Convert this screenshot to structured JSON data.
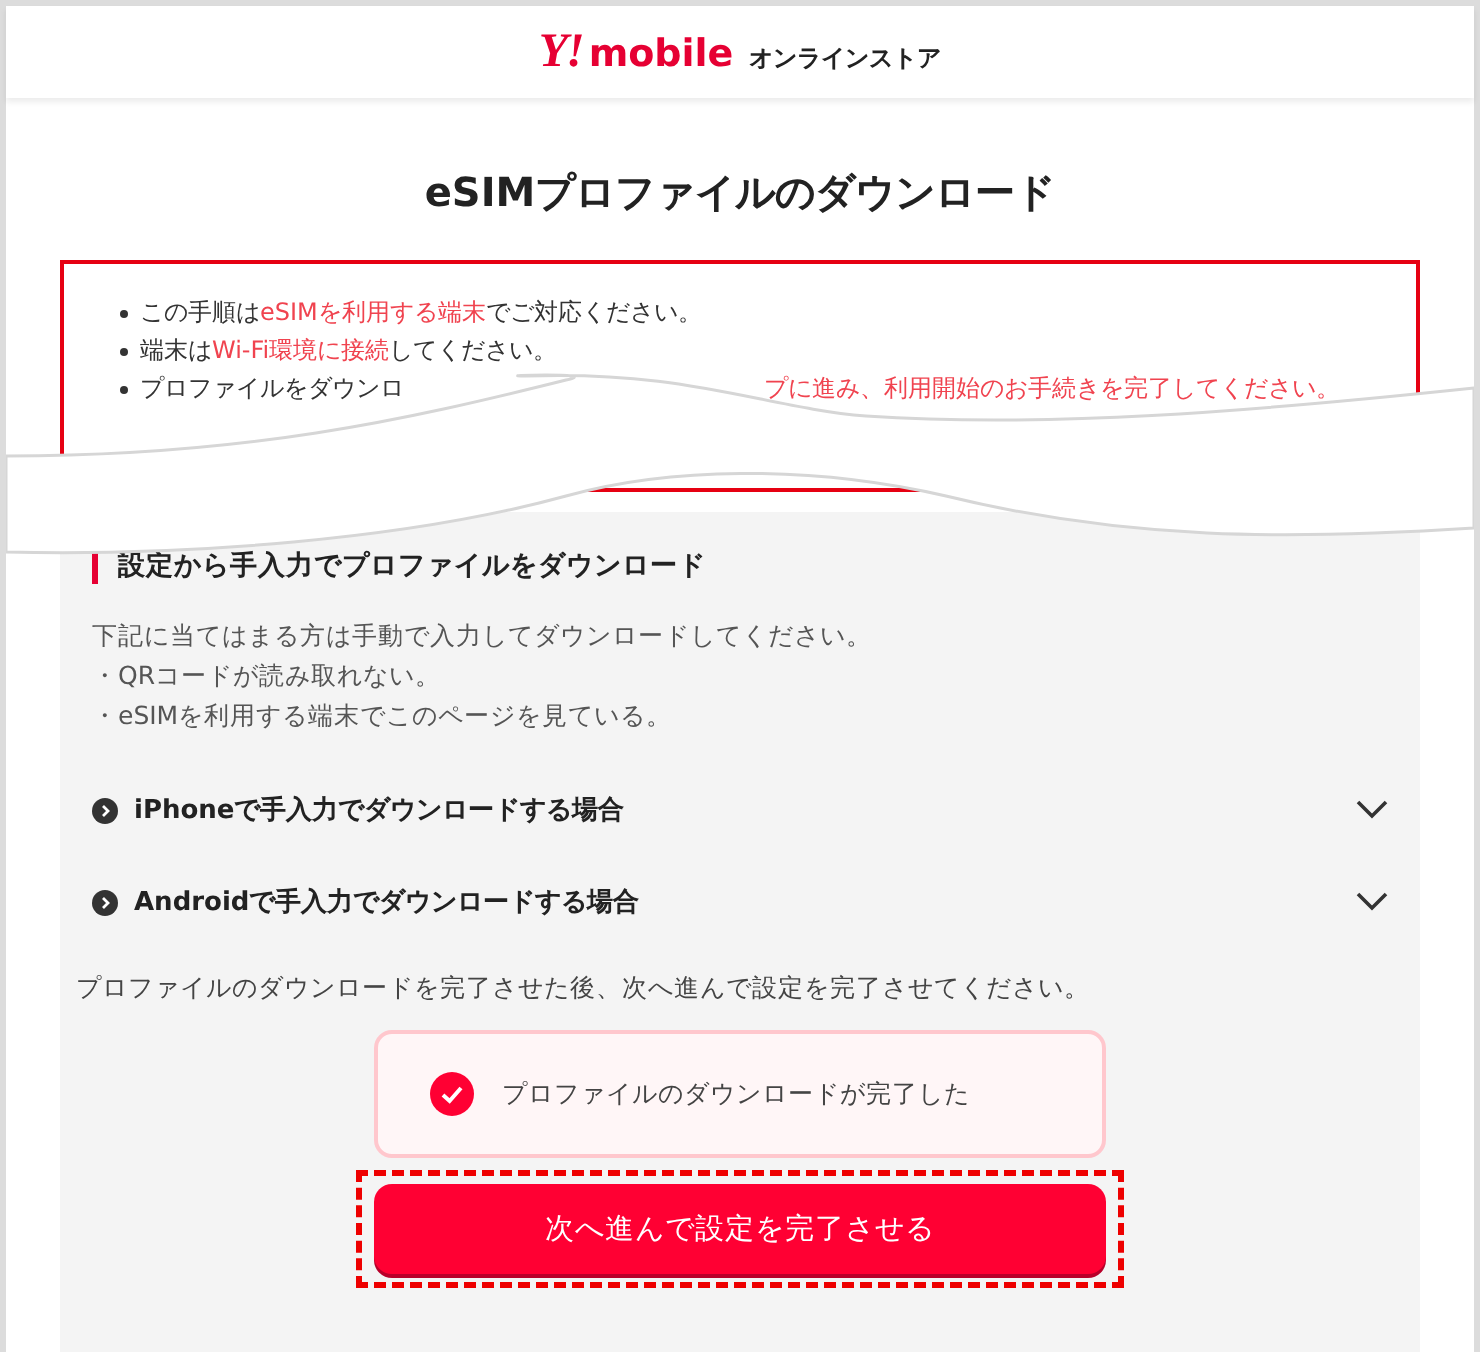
{
  "header": {
    "logo_mark": "Y!",
    "logo_word": "mobile",
    "store_label": "オンラインストア"
  },
  "title": "eSIMプロファイルのダウンロード",
  "notices": [
    {
      "cut": false,
      "parts": [
        {
          "text": "この手順は",
          "highlight": false
        },
        {
          "text": "eSIMを利用する端末",
          "highlight": true
        },
        {
          "text": "でご対応ください。",
          "highlight": false
        }
      ]
    },
    {
      "cut": false,
      "parts": [
        {
          "text": "端末は",
          "highlight": false
        },
        {
          "text": "Wi-Fi環境に接続",
          "highlight": true
        },
        {
          "text": "してください。",
          "highlight": false
        }
      ]
    },
    {
      "cut": true,
      "parts": [
        {
          "text": "プロファイルをダウンロ",
          "highlight": false
        },
        {
          "text": "プに進み、利用開始のお手続きを完了してください。",
          "highlight": true
        }
      ]
    }
  ],
  "section": {
    "heading": "設定から手入力でプロファイルをダウンロード",
    "intro": [
      "下記に当てはまる方は手動で入力してダウンロードしてください。",
      "・QRコードが読み取れない。",
      "・eSIMを利用する端末でこのページを見ている。"
    ],
    "accordions": [
      {
        "label": "iPhoneで手入力でダウンロードする場合",
        "expanded": false
      },
      {
        "label": "Androidで手入力でダウンロードする場合",
        "expanded": false
      }
    ],
    "note": "プロファイルのダウンロードを完了させた後、次へ進んで設定を完了させてください。",
    "confirm": {
      "label": "プロファイルのダウンロードが完了した",
      "checked": true
    },
    "next_button": {
      "label": "次へ進んで設定を完了させる",
      "highlighted": true
    }
  }
}
